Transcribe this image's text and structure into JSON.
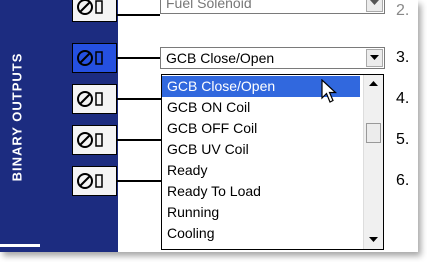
{
  "panel": {
    "label": "BINARY OUTPUTS"
  },
  "top_combo": {
    "value": "Fuel Solenoid",
    "row_number": "2."
  },
  "current_combo": {
    "value": "GCB Close/Open",
    "row_number": "3."
  },
  "row_numbers": [
    "4.",
    "5.",
    "6."
  ],
  "dropdown": {
    "items": [
      "GCB Close/Open",
      "GCB ON Coil",
      "GCB OFF Coil",
      "GCB UV Coil",
      "Ready",
      "Ready To Load",
      "Running",
      "Cooling"
    ],
    "highlighted_index": 0
  },
  "colors": {
    "panel_blue": "#1c2c80",
    "selected_relay": "#2550e0",
    "highlight": "#3168de"
  },
  "icons": {
    "relay": "relay-contact-icon",
    "cursor": "mouse-pointer-icon"
  }
}
